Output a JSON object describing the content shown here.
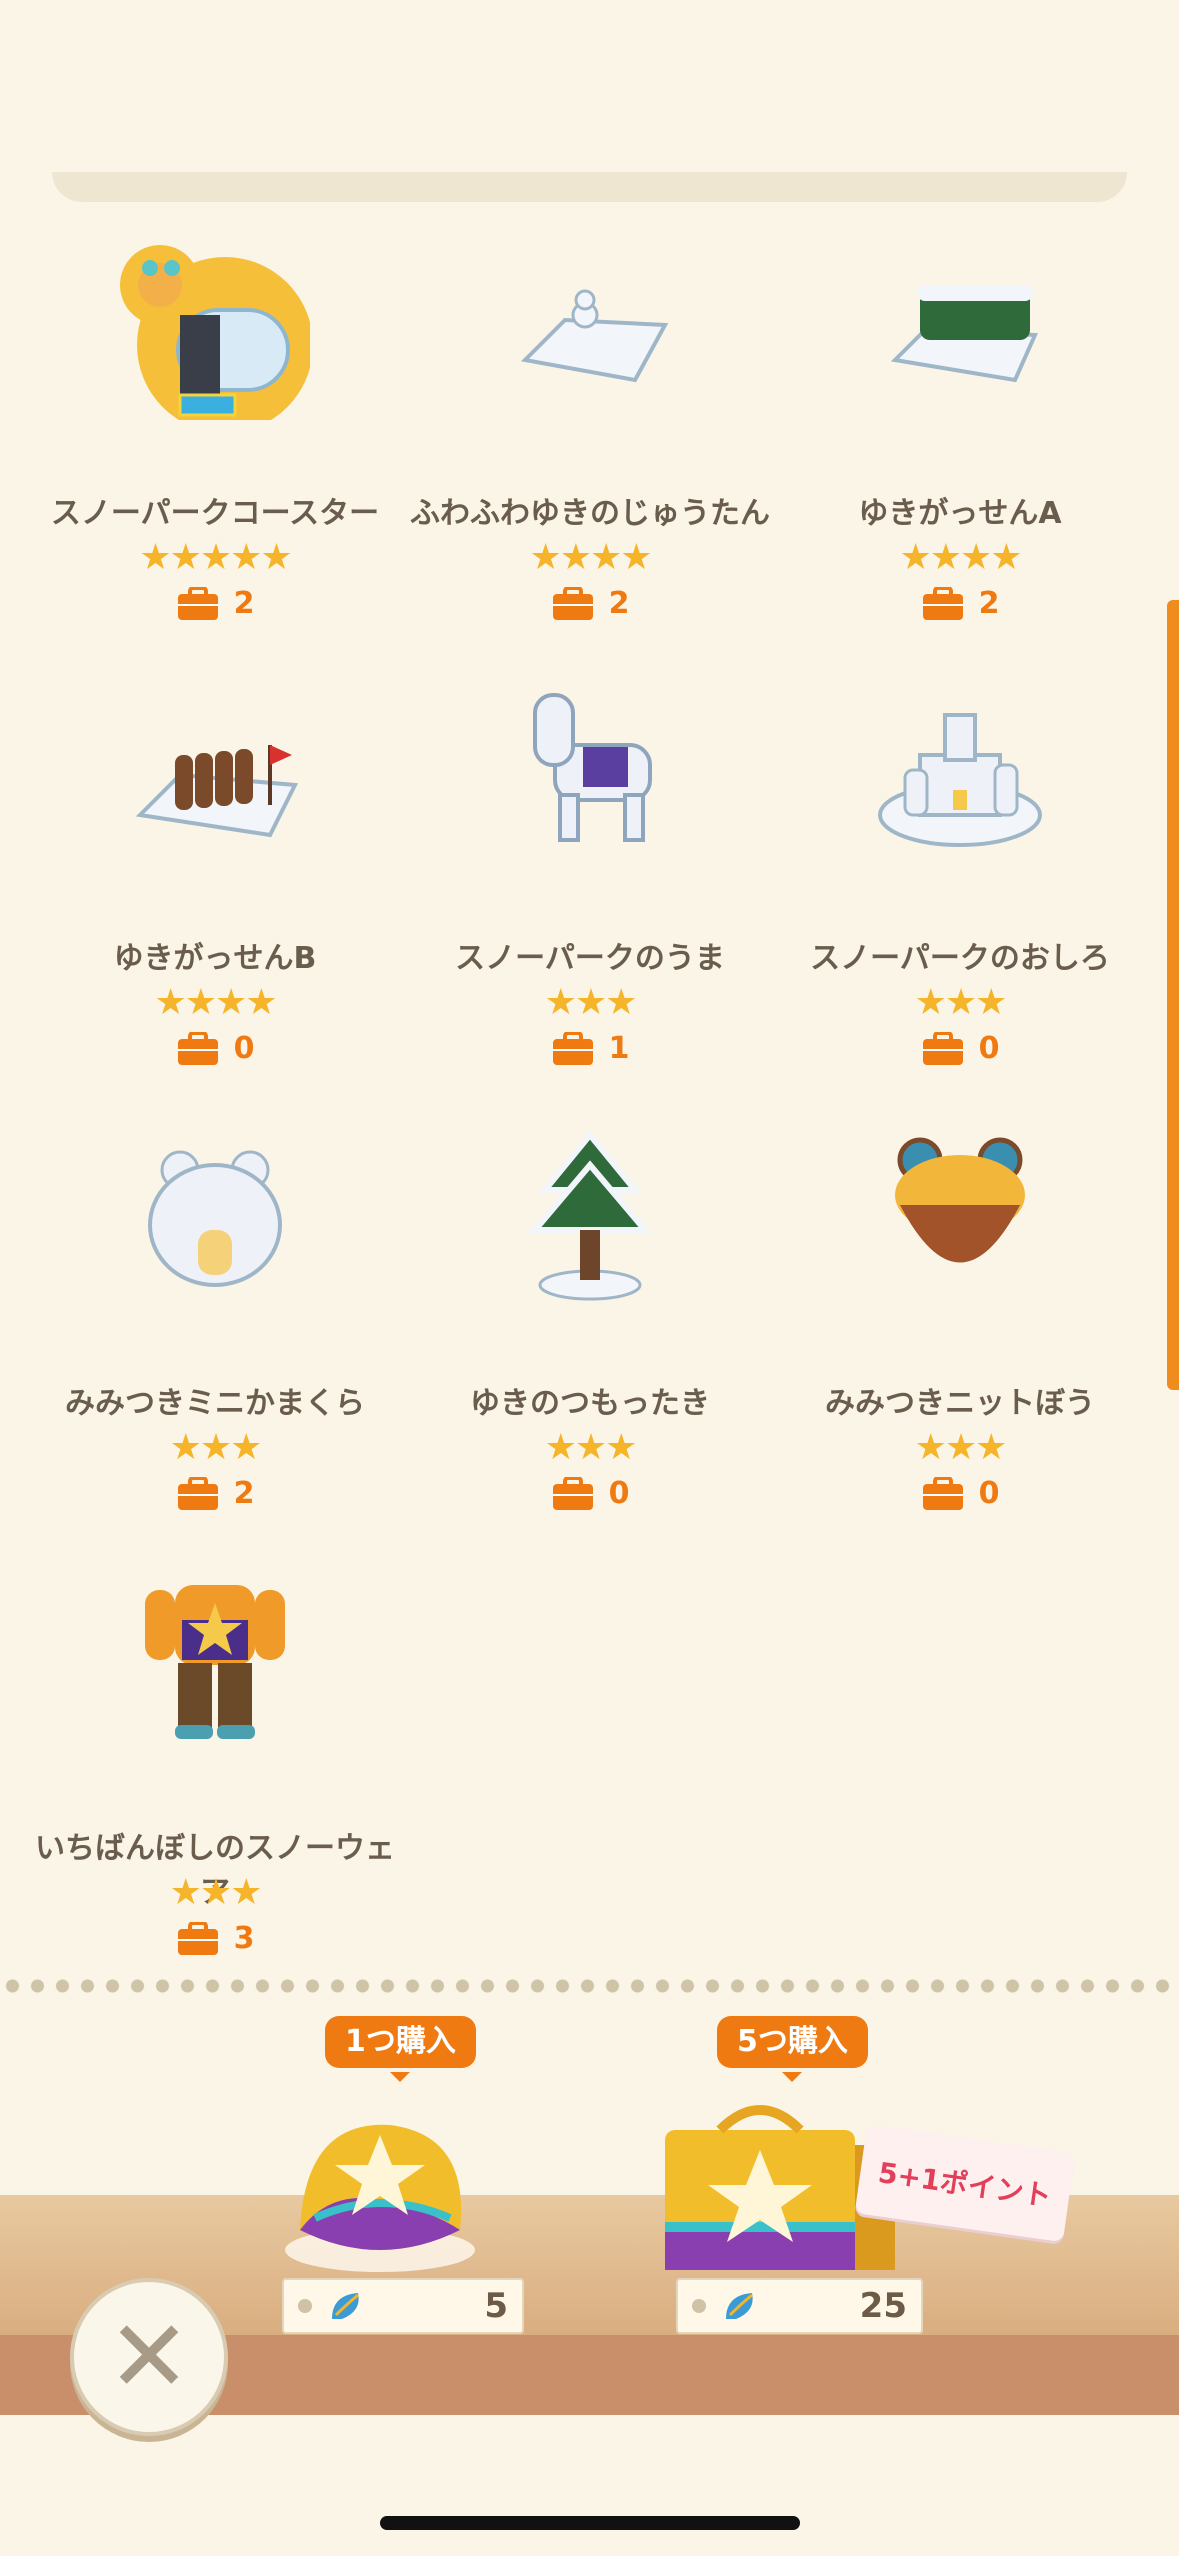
{
  "items": [
    {
      "name": "スノーパークコースター",
      "stars": "★★★★★",
      "count": "2",
      "icon": "snow-coaster-icon"
    },
    {
      "name": "ふわふわゆきのじゅうたん",
      "stars": "★★★★",
      "count": "2",
      "icon": "snow-rug-icon"
    },
    {
      "name": "ゆきがっせんA",
      "stars": "★★★★",
      "count": "2",
      "icon": "snow-wall-a-icon"
    },
    {
      "name": "ゆきがっせんB",
      "stars": "★★★★",
      "count": "0",
      "icon": "snow-fence-b-icon"
    },
    {
      "name": "スノーパークのうま",
      "stars": "★★★",
      "count": "1",
      "icon": "snow-horse-icon"
    },
    {
      "name": "スノーパークのおしろ",
      "stars": "★★★",
      "count": "0",
      "icon": "snow-castle-icon"
    },
    {
      "name": "みみつきミニかまくら",
      "stars": "★★★",
      "count": "2",
      "icon": "mini-kamakura-icon"
    },
    {
      "name": "ゆきのつもったき",
      "stars": "★★★",
      "count": "0",
      "icon": "snowy-tree-icon"
    },
    {
      "name": "みみつきニットぼう",
      "stars": "★★★",
      "count": "0",
      "icon": "knit-hat-icon"
    },
    {
      "name": "いちばんぼしのスノーウェア",
      "stars": "★★★",
      "count": "3",
      "icon": "snow-wear-icon"
    }
  ],
  "shop": {
    "single": {
      "tag": "1つ購入",
      "price": "5"
    },
    "five": {
      "tag": "5つ購入",
      "price": "25",
      "bonus": "5+1ポイント"
    }
  },
  "colors": {
    "accent": "#f07a12",
    "star": "#f5b42a",
    "background": "#faf5e6"
  }
}
